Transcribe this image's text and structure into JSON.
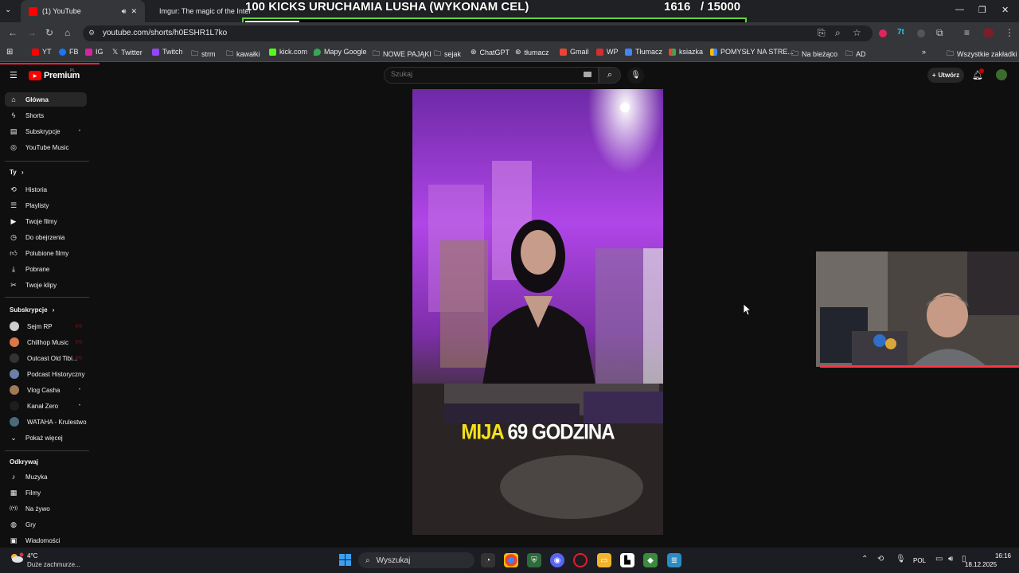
{
  "browser": {
    "tabs": [
      {
        "label": "(1) YouTube",
        "active": true
      },
      {
        "label": "Imgur: The magic of the Inter",
        "active": false
      }
    ],
    "url": "youtube.com/shorts/h0ESHR1L7ko",
    "bookmarks": [
      "YT",
      "FB",
      "IG",
      "Twitter",
      "Twitch",
      "strm",
      "kawałki",
      "kick.com",
      "Mapy Google",
      "NOWE PAJĄKI",
      "sejak",
      "ChatGPT",
      "tłumacz",
      "Gmail",
      "WP",
      "Tłumacz",
      "ksiazka",
      "POMYSŁY NA STRE...",
      "Na bieżąco",
      "AD"
    ],
    "all_bookmarks_label": "Wszystkie zakładki"
  },
  "stream_overlay": {
    "goal_title": "100 KICKS URUCHAMIA LUSHA (WYKONAM CEL)",
    "goal_current": "1616",
    "goal_total": "/ 15000",
    "goal_progress": 0.108
  },
  "youtube": {
    "logo_text": "Premium",
    "logo_badge": "PL",
    "search_placeholder": "Szukaj",
    "create_label": "Utwórz",
    "notification_count": "1",
    "nav_main": [
      {
        "label": "Główna",
        "icon": "home-icon",
        "active": true
      },
      {
        "label": "Shorts",
        "icon": "shorts-icon"
      },
      {
        "label": "Subskrypcje",
        "icon": "subscriptions-icon"
      },
      {
        "label": "YouTube Music",
        "icon": "music-icon"
      }
    ],
    "you_heading": "Ty",
    "nav_you": [
      {
        "label": "Historia",
        "icon": "history-icon"
      },
      {
        "label": "Playlisty",
        "icon": "playlist-icon"
      },
      {
        "label": "Twoje filmy",
        "icon": "video-icon"
      },
      {
        "label": "Do obejrzenia",
        "icon": "clock-icon"
      },
      {
        "label": "Polubione filmy",
        "icon": "like-icon"
      },
      {
        "label": "Pobrane",
        "icon": "download-icon"
      },
      {
        "label": "Twoje klipy",
        "icon": "scissors-icon"
      }
    ],
    "subs_heading": "Subskrypcje",
    "subscriptions": [
      {
        "label": "Sejm RP",
        "live": true,
        "color": "#cfcfcf"
      },
      {
        "label": "Chillhop Music",
        "live": true,
        "color": "#d9774a"
      },
      {
        "label": "Outcast Old Tibi...",
        "live": true,
        "color": "#333333"
      },
      {
        "label": "Podcast Historyczny",
        "live": false,
        "color": "#6b7fa6"
      },
      {
        "label": "Vlog Casha",
        "live": false,
        "color": "#a07a55"
      },
      {
        "label": "Kanał Zero",
        "live": false,
        "color": "#1e1e1e"
      },
      {
        "label": "WATAHA - Krulestwo",
        "live": false,
        "color": "#4a6a7a"
      }
    ],
    "show_more": "Pokaż więcej",
    "explore_heading": "Odkrywaj",
    "nav_explore": [
      {
        "label": "Muzyka",
        "icon": "music-note-icon"
      },
      {
        "label": "Filmy",
        "icon": "film-icon"
      },
      {
        "label": "Na żywo",
        "icon": "live-icon"
      },
      {
        "label": "Gry",
        "icon": "gamepad-icon"
      },
      {
        "label": "Wiadomości",
        "icon": "news-icon"
      }
    ],
    "short_caption_highlight": "MIJA",
    "short_caption_rest": "69 GODZINA"
  },
  "taskbar": {
    "weather_temp": "4°C",
    "weather_desc": "Duże zachmurze...",
    "search_label": "Wyszukaj",
    "language": "POL",
    "time": "16:16",
    "date": "18.12.2025"
  }
}
